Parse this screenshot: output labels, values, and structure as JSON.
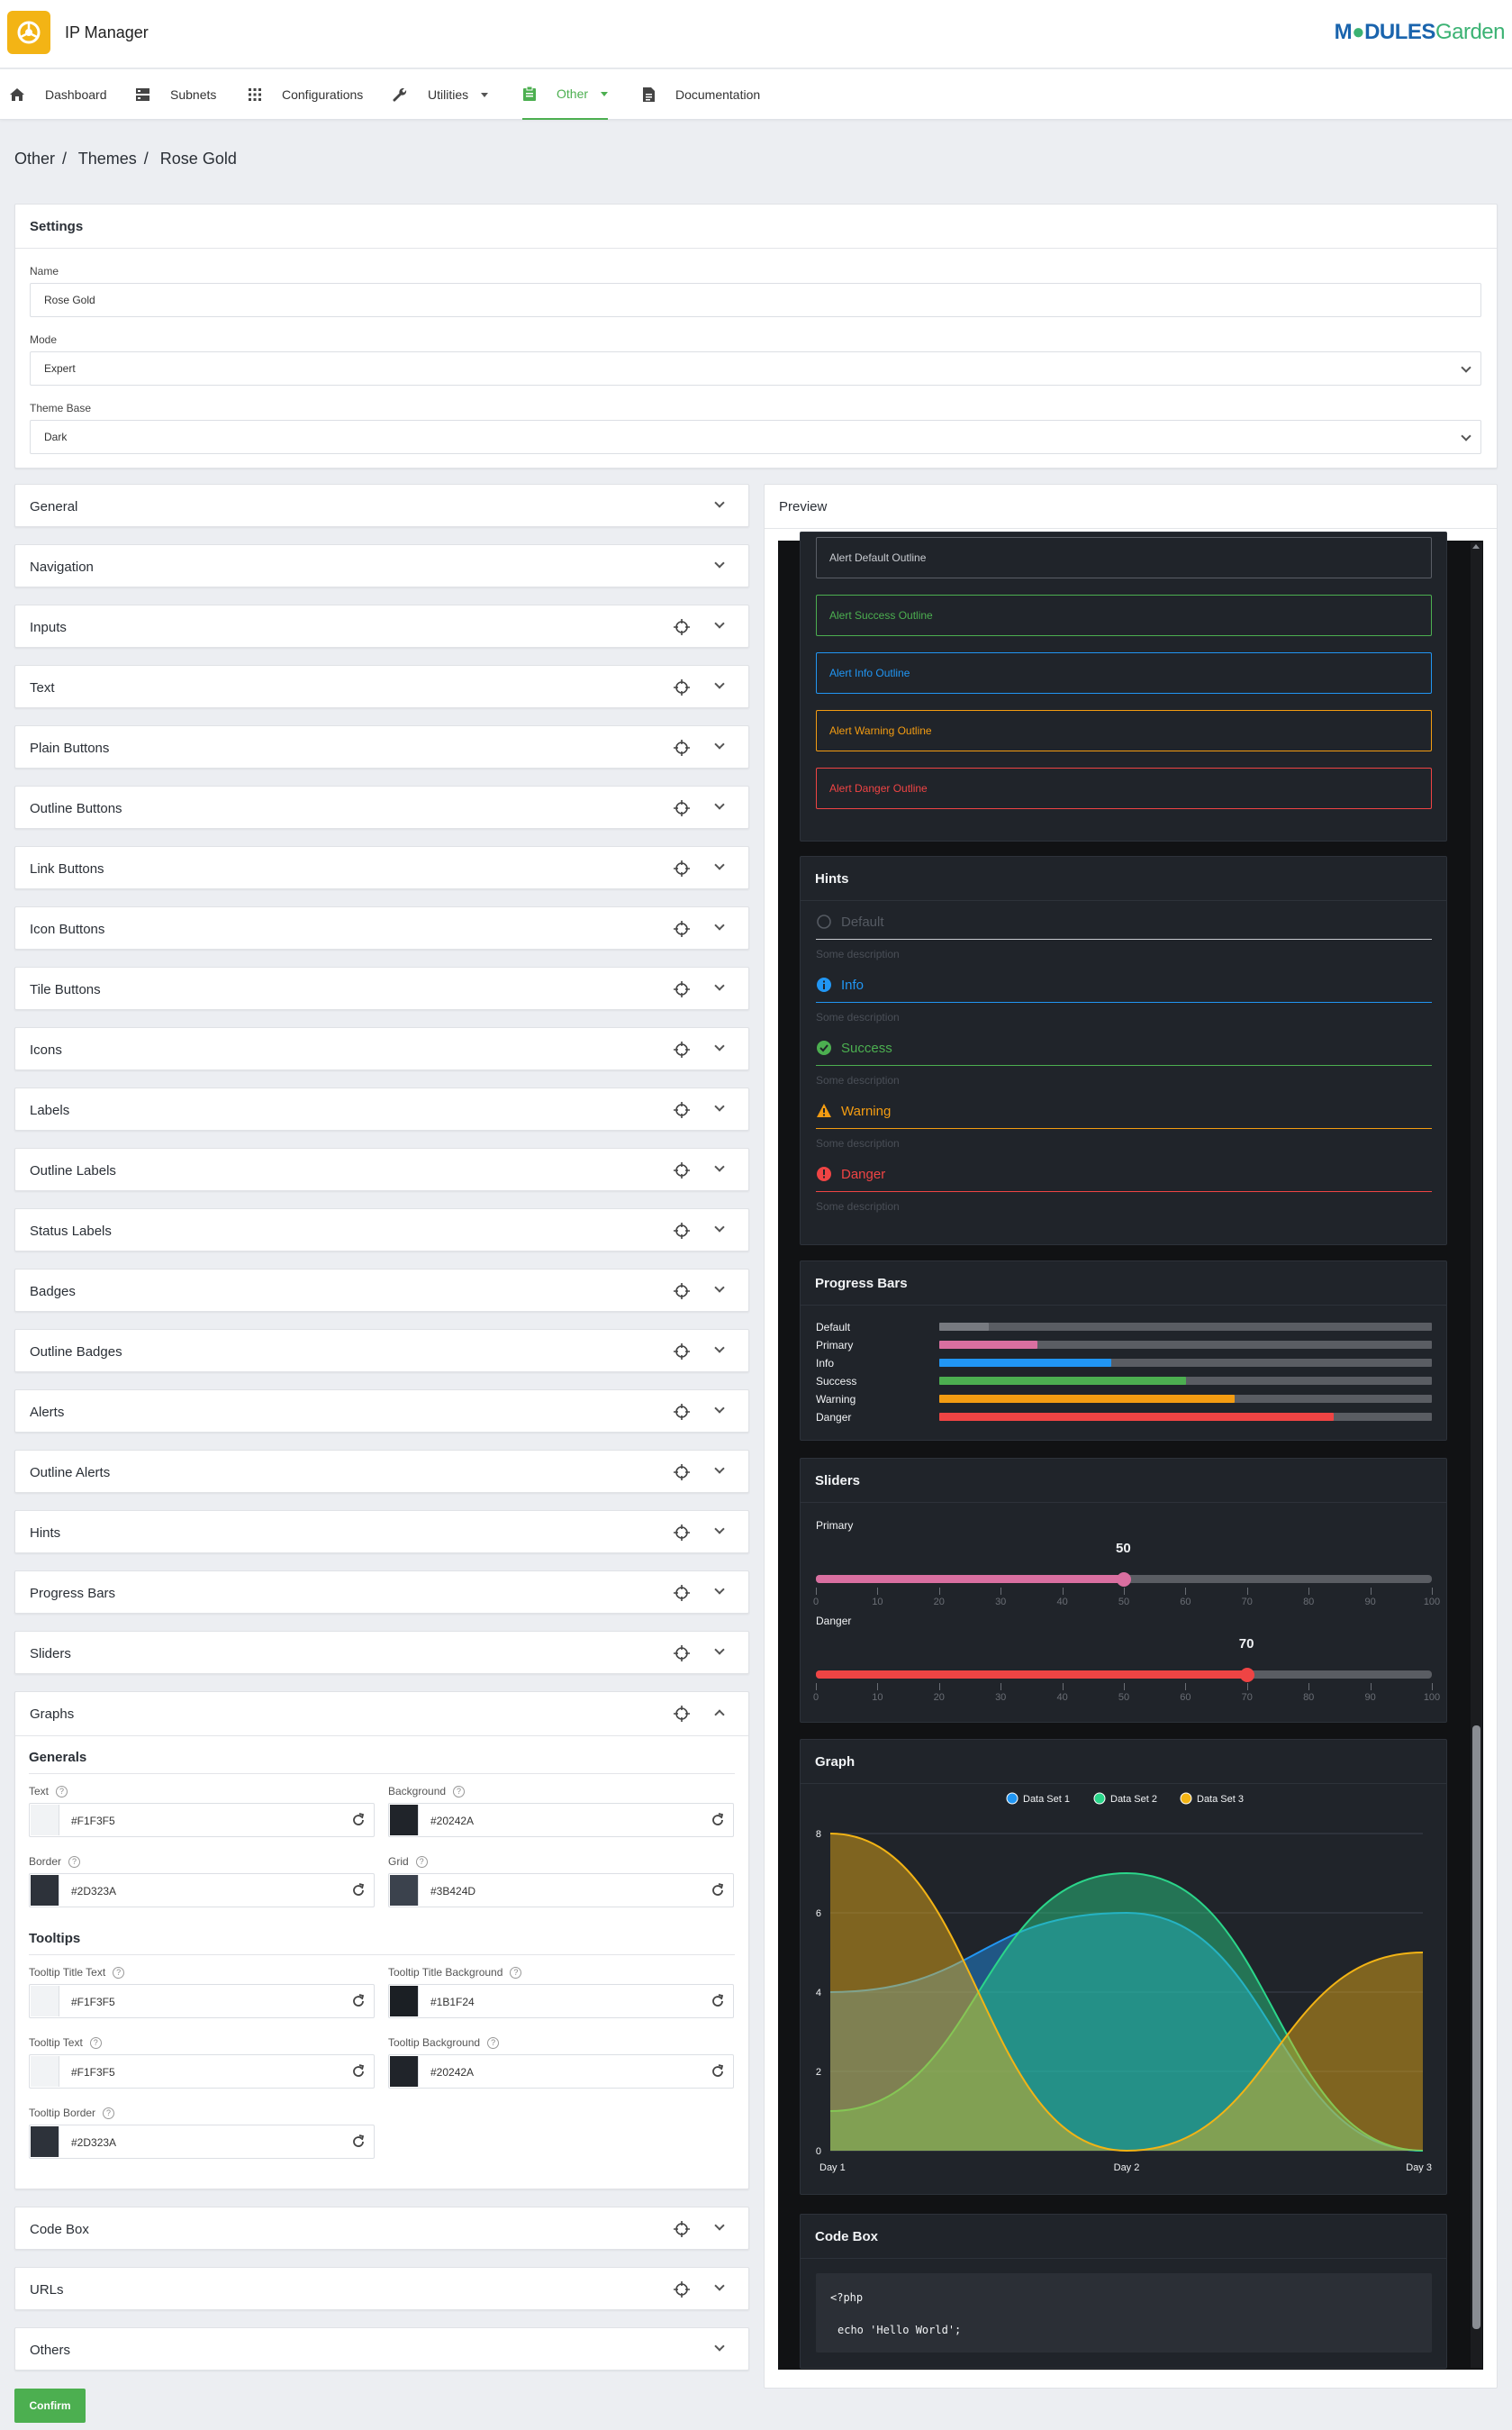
{
  "app": {
    "title": "IP Manager",
    "brand_prefix": "M",
    "brand_mid": "DULES",
    "brand_suffix": "Garden"
  },
  "nav": [
    {
      "label": "Dashboard",
      "icon": "home-icon"
    },
    {
      "label": "Subnets",
      "icon": "server-icon"
    },
    {
      "label": "Configurations",
      "icon": "grid-icon"
    },
    {
      "label": "Utilities",
      "icon": "wrench-icon"
    },
    {
      "label": "Other",
      "icon": "clipboard-icon",
      "active": true
    },
    {
      "label": "Documentation",
      "icon": "document-icon"
    }
  ],
  "breadcrumb": [
    "Other",
    "Themes",
    "Rose Gold"
  ],
  "settings": {
    "title": "Settings",
    "name_label": "Name",
    "name_value": "Rose Gold",
    "mode_label": "Mode",
    "mode_value": "Expert",
    "base_label": "Theme Base",
    "base_value": "Dark"
  },
  "sections": [
    "General",
    "Navigation",
    "Inputs",
    "Text",
    "Plain Buttons",
    "Outline Buttons",
    "Link Buttons",
    "Icon Buttons",
    "Tile Buttons",
    "Icons",
    "Labels",
    "Outline Labels",
    "Status Labels",
    "Badges",
    "Outline Badges",
    "Alerts",
    "Outline Alerts",
    "Hints",
    "Progress Bars",
    "Sliders",
    "Graphs"
  ],
  "graphs": {
    "generals_title": "Generals",
    "tooltips_title": "Tooltips",
    "generals": [
      {
        "label": "Text",
        "value": "#F1F3F5"
      },
      {
        "label": "Background",
        "value": "#20242A"
      },
      {
        "label": "Border",
        "value": "#2D323A"
      },
      {
        "label": "Grid",
        "value": "#3B424D"
      }
    ],
    "tooltips": [
      {
        "label": "Tooltip Title Text",
        "value": "#F1F3F5"
      },
      {
        "label": "Tooltip Title Background",
        "value": "#1B1F24"
      },
      {
        "label": "Tooltip Text",
        "value": "#F1F3F5"
      },
      {
        "label": "Tooltip Background",
        "value": "#20242A"
      },
      {
        "label": "Tooltip Border",
        "value": "#2D323A"
      }
    ]
  },
  "after_sections": [
    "Code Box",
    "URLs",
    "Others"
  ],
  "confirm_label": "Confirm",
  "preview": {
    "title": "Preview",
    "alerts": [
      {
        "label": "Alert Default Outline",
        "color": "#5a5e66",
        "text": "#c8cbd0"
      },
      {
        "label": "Alert Success Outline",
        "color": "#4caf50",
        "text": "#4caf50"
      },
      {
        "label": "Alert Info Outline",
        "color": "#2196f3",
        "text": "#2196f3"
      },
      {
        "label": "Alert Warning Outline",
        "color": "#f39c12",
        "text": "#f39c12"
      },
      {
        "label": "Alert Danger Outline",
        "color": "#ef4444",
        "text": "#ef4444"
      }
    ],
    "hints_title": "Hints",
    "hints": [
      {
        "label": "Default",
        "color": "#555a62",
        "line": "#c8cbd0",
        "desc": "Some description"
      },
      {
        "label": "Info",
        "color": "#2196f3",
        "line": "#2196f3",
        "desc": "Some description"
      },
      {
        "label": "Success",
        "color": "#4caf50",
        "line": "#4caf50",
        "desc": "Some description"
      },
      {
        "label": "Warning",
        "color": "#f39c12",
        "line": "#f39c12",
        "desc": "Some description"
      },
      {
        "label": "Danger",
        "color": "#ef4444",
        "line": "#ef4444",
        "desc": "Some description"
      }
    ],
    "progress_title": "Progress Bars",
    "progress": [
      {
        "label": "Default",
        "value": 10,
        "color": "#777a80"
      },
      {
        "label": "Primary",
        "value": 20,
        "color": "#d96fa0"
      },
      {
        "label": "Info",
        "value": 35,
        "color": "#2196f3"
      },
      {
        "label": "Success",
        "value": 50,
        "color": "#4caf50"
      },
      {
        "label": "Warning",
        "value": 60,
        "color": "#f39c12"
      },
      {
        "label": "Danger",
        "value": 80,
        "color": "#ef4444"
      }
    ],
    "sliders_title": "Sliders",
    "sliders": [
      {
        "label": "Primary",
        "value": 50,
        "color": "#d96fa0"
      },
      {
        "label": "Danger",
        "value": 70,
        "color": "#ef4444"
      }
    ],
    "slider_ticks": [
      "0",
      "10",
      "20",
      "30",
      "40",
      "50",
      "60",
      "70",
      "80",
      "90",
      "100"
    ],
    "graph_title": "Graph",
    "codebox_title": "Code Box",
    "code_lines": [
      "<?php",
      "echo 'Hello World';"
    ]
  },
  "chart_data": {
    "type": "area",
    "categories": [
      "Day 1",
      "Day 2",
      "Day 3"
    ],
    "ylim": [
      0,
      8
    ],
    "yticks": [
      "0",
      "2",
      "4",
      "6",
      "8"
    ],
    "series": [
      {
        "name": "Data Set 1",
        "values": [
          4,
          6,
          0
        ],
        "color": "#2196f3"
      },
      {
        "name": "Data Set 2",
        "values": [
          1,
          7,
          0
        ],
        "color": "#2bd68a"
      },
      {
        "name": "Data Set 3",
        "values": [
          8,
          0,
          5
        ],
        "color": "#f3b415"
      }
    ]
  }
}
